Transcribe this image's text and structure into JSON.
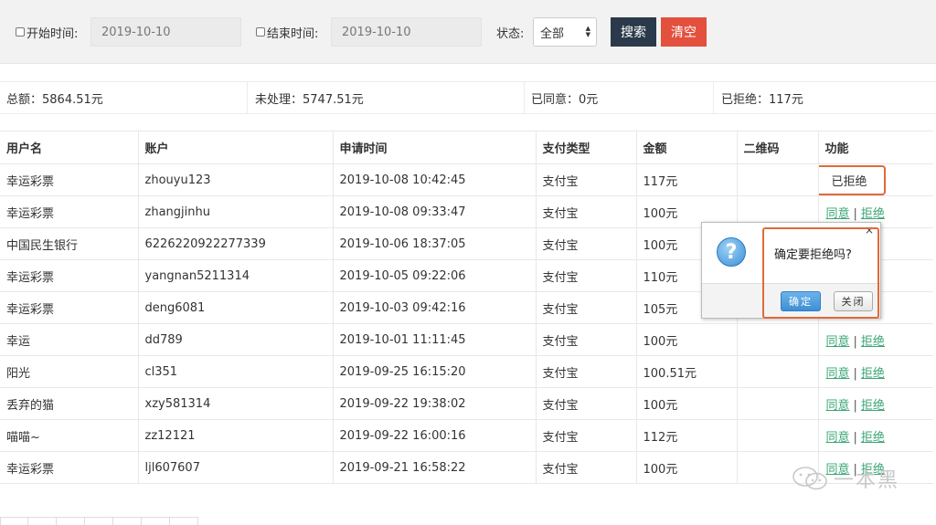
{
  "filter": {
    "start_label": "开始时间:",
    "start_value": "2019-10-10",
    "end_label": "结束时间:",
    "end_value": "2019-10-10",
    "status_label": "状态:",
    "status_value": "全部",
    "search_label": "搜索",
    "clear_label": "清空"
  },
  "summary": {
    "total": "总额：5864.51元",
    "pending": "未处理：5747.51元",
    "approved": "已同意：0元",
    "rejected": "已拒绝：117元"
  },
  "table": {
    "headers": [
      "用户名",
      "账户",
      "申请时间",
      "支付类型",
      "金额",
      "二维码",
      "功能"
    ],
    "rows": [
      {
        "user": "幸运彩票",
        "account": "zhouyu123",
        "time": "2019-10-08 10:42:45",
        "pay": "支付宝",
        "amount": "117元",
        "status": "已拒绝"
      },
      {
        "user": "幸运彩票",
        "account": "zhangjinhu",
        "time": "2019-10-08 09:33:47",
        "pay": "支付宝",
        "amount": "100元"
      },
      {
        "user": "中国民生银行",
        "account": "6226220922277339",
        "time": "2019-10-06 18:37:05",
        "pay": "支付宝",
        "amount": "100元"
      },
      {
        "user": "幸运彩票",
        "account": "yangnan5211314",
        "time": "2019-10-05 09:22:06",
        "pay": "支付宝",
        "amount": "110元"
      },
      {
        "user": "幸运彩票",
        "account": "deng6081",
        "time": "2019-10-03 09:42:16",
        "pay": "支付宝",
        "amount": "105元"
      },
      {
        "user": "幸运",
        "account": "dd789",
        "time": "2019-10-01 11:11:45",
        "pay": "支付宝",
        "amount": "100元"
      },
      {
        "user": "阳光",
        "account": "cl351",
        "time": "2019-09-25 16:15:20",
        "pay": "支付宝",
        "amount": "100.51元"
      },
      {
        "user": "丢弃的猫",
        "account": "xzy581314",
        "time": "2019-09-22 19:38:02",
        "pay": "支付宝",
        "amount": "100元"
      },
      {
        "user": "喵喵~",
        "account": "zz12121",
        "time": "2019-09-22 16:00:16",
        "pay": "支付宝",
        "amount": "112元"
      },
      {
        "user": "幸运彩票",
        "account": "ljl607607",
        "time": "2019-09-21 16:58:22",
        "pay": "支付宝",
        "amount": "100元"
      }
    ],
    "approve_label": "同意",
    "reject_label": "拒绝",
    "separator": "|"
  },
  "dialog": {
    "close": "×",
    "icon": "?",
    "message": "确定要拒绝吗?",
    "ok_label": "确定",
    "cancel_label": "关闭"
  },
  "watermark": {
    "text": "一本黑"
  },
  "colors": {
    "accent_link": "#3aa675",
    "search_button": "#2b3a4a",
    "clear_button": "#e3503e",
    "highlight": "#e06a3a"
  }
}
